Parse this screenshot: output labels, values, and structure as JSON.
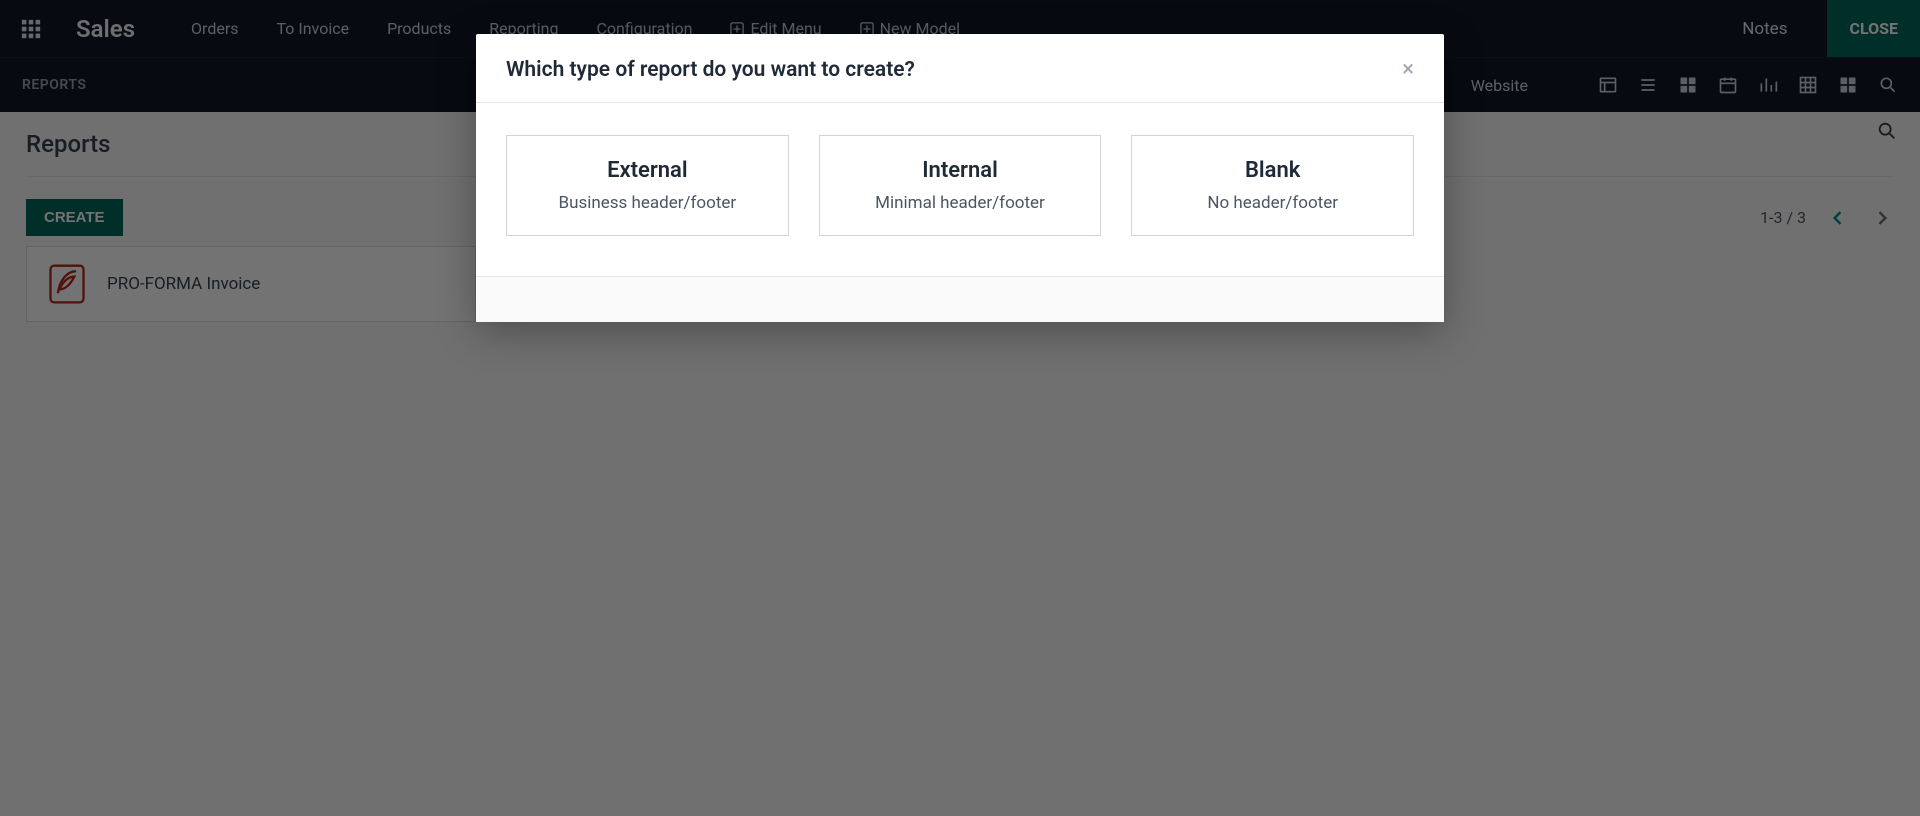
{
  "nav": {
    "brand": "Sales",
    "items": [
      "Orders",
      "To Invoice",
      "Products",
      "Reporting",
      "Configuration"
    ],
    "studio_items": [
      "Edit Menu",
      "New Model"
    ],
    "notes": "Notes",
    "close": "CLOSE"
  },
  "toolbar": {
    "breadcrumb": "REPORTS",
    "website_label": "Website"
  },
  "content": {
    "title": "Reports",
    "create_label": "CREATE",
    "pager_text": "1-3 / 3",
    "reports": [
      {
        "name": "PRO-FORMA Invoice"
      },
      {
        "name": ""
      },
      {
        "name": ""
      }
    ]
  },
  "modal": {
    "title": "Which type of report do you want to create?",
    "options": [
      {
        "title": "External",
        "subtitle": "Business header/footer"
      },
      {
        "title": "Internal",
        "subtitle": "Minimal header/footer"
      },
      {
        "title": "Blank",
        "subtitle": "No header/footer"
      }
    ]
  }
}
